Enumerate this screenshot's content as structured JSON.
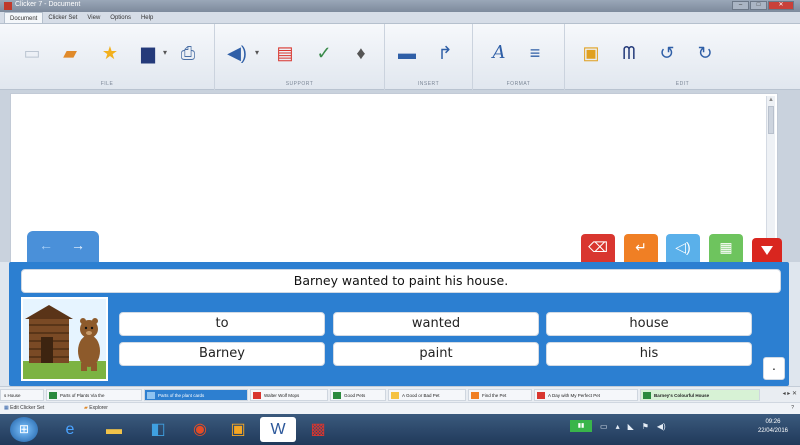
{
  "window": {
    "title": "Clicker 7 - Document"
  },
  "menu_tabs": [
    "Document",
    "Clicker Set",
    "View",
    "Options",
    "Help"
  ],
  "ribbon_groups": [
    "FILE",
    "SUPPORT",
    "INSERT",
    "FORMAT",
    "EDIT"
  ],
  "nav": {
    "back": "←",
    "forward": "→"
  },
  "sentence": "Barney wanted to paint his house.",
  "grid": {
    "row1": [
      "to",
      "wanted",
      "house"
    ],
    "row2": [
      "Barney",
      "paint",
      "his"
    ],
    "punctuation": "."
  },
  "doc_tabs": [
    {
      "label": "s House",
      "icon_color": "#d9362f"
    },
    {
      "label": "Parts of Plants Via the",
      "icon_color": "#2b8a3e"
    },
    {
      "label": "Parts of the plant cards",
      "icon_color": "#4a90d9"
    },
    {
      "label": "Walter Wolf Mops",
      "icon_color": "#d9362f"
    },
    {
      "label": "Good Pets",
      "icon_color": "#2b8a3e"
    },
    {
      "label": "A Good or Bad Pet",
      "icon_color": "#f5c242"
    },
    {
      "label": "Find the Pet",
      "icon_color": "#f07f24"
    },
    {
      "label": "A Day with My Perfect Pet",
      "icon_color": "#d9362f"
    },
    {
      "label": "Barney's Colourful House",
      "icon_color": "#2b8a3e"
    }
  ],
  "status": {
    "left": "Edit Clicker Set",
    "right": "Explorer"
  },
  "clock": {
    "time": "09:26",
    "date": "22/04/2016"
  },
  "colors": {
    "panel_blue": "#2c7fd1",
    "delete_red": "#d9362f",
    "enter_orange": "#f07f24",
    "speak_blue": "#5ab0ea",
    "green": "#6ec45e"
  }
}
